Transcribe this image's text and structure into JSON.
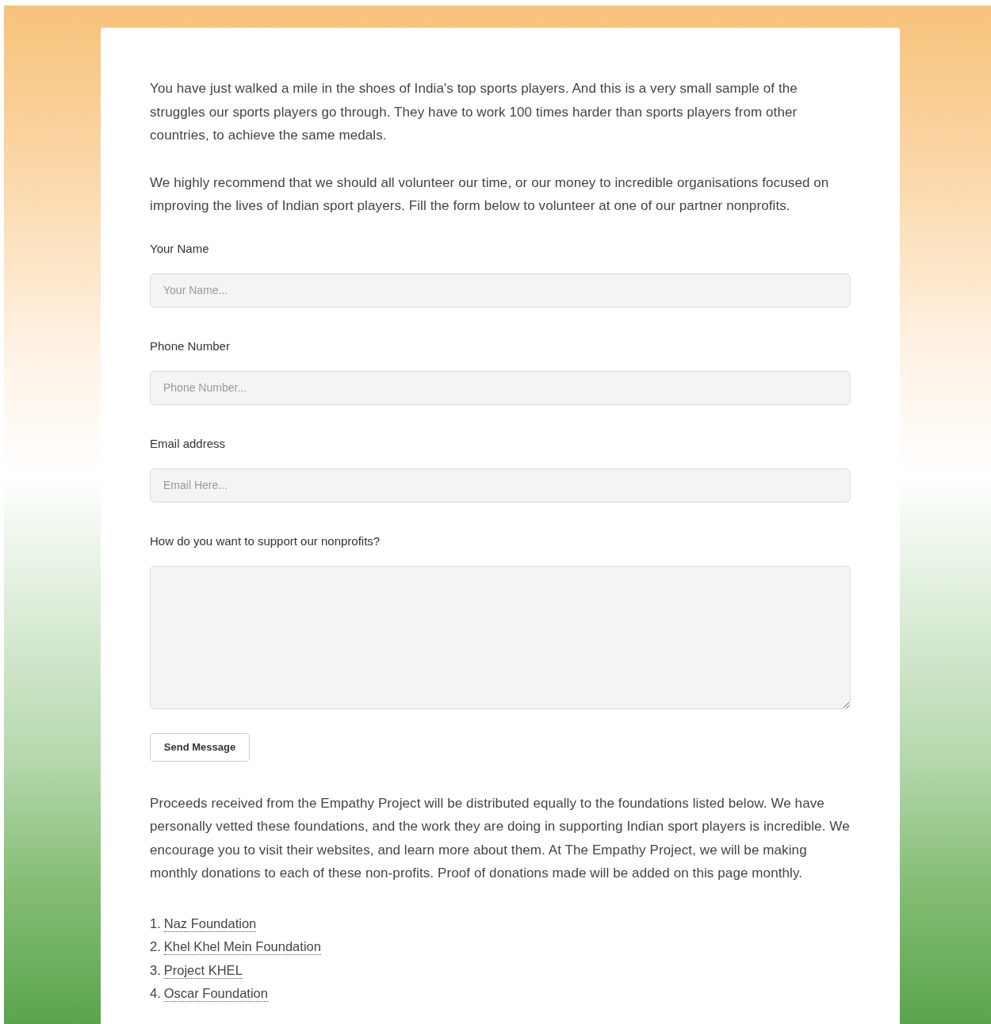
{
  "intro": [
    "You have just walked a mile in the shoes of India's top sports players. And this is a very small sample of the struggles our sports players go through. They have to work 100 times harder than sports players from other countries, to achieve the same medals.",
    "We highly recommend that we should all volunteer our time, or our money to incredible organisations focused on improving the lives of Indian sport players. Fill the form below to volunteer at one of our partner nonprofits."
  ],
  "form": {
    "fields": [
      {
        "kind": "input",
        "label": "Your Name",
        "placeholder": "Your Name..."
      },
      {
        "kind": "input",
        "label": "Phone Number",
        "placeholder": "Phone Number..."
      },
      {
        "kind": "input",
        "label": "Email address",
        "placeholder": "Email Here..."
      },
      {
        "kind": "textarea",
        "label": "How do you want to support our nonprofits?"
      }
    ],
    "submit": "Send Message"
  },
  "outro": "Proceeds received from the Empathy Project will be distributed equally to the foundations listed below. We have personally vetted these foundations, and the work they are doing in supporting Indian sport players is incredible. We encourage you to visit their websites, and learn more about them. At The Empathy Project, we will be making monthly donations to each of these non-profits. Proof of donations made will be added on this page monthly.",
  "foundations": [
    {
      "number": "1.",
      "name": "Naz Foundation"
    },
    {
      "number": "2.",
      "name": "Khel Khel Mein Foundation"
    },
    {
      "number": "3.",
      "name": "Project KHEL"
    },
    {
      "number": "4.",
      "name": "Oscar Foundation"
    }
  ]
}
